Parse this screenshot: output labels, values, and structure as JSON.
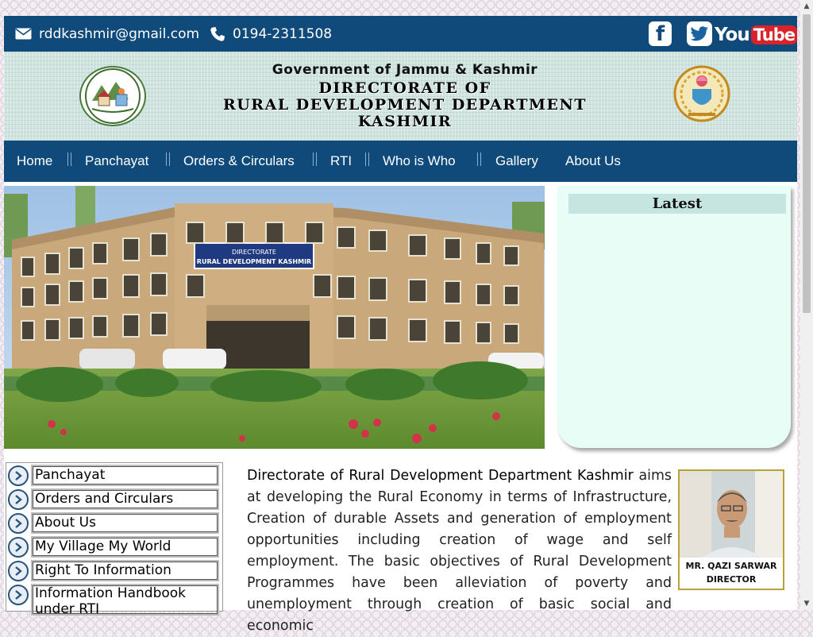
{
  "topbar": {
    "email": "rddkashmir@gmail.com",
    "phone": "0194-2311508",
    "social": {
      "facebook": "f",
      "youtube_you": "You",
      "youtube_tube": "Tube"
    }
  },
  "banner": {
    "gov_line": "Government of Jammu & Kashmir",
    "title_line1": "DIRECTORATE OF",
    "title_line2": "RURAL DEVELOPMENT DEPARTMENT",
    "title_line3": "KASHMIR",
    "left_logo_text": "MY VILLAGE, MY WORLD"
  },
  "nav": {
    "items": [
      "Home",
      "Panchayat",
      "Orders & Circulars",
      "RTI",
      "Who is Who",
      "Gallery",
      "About Us"
    ]
  },
  "hero": {
    "sign_line1": "DIRECTORATE",
    "sign_line2": "RURAL DEVELOPMENT KASHMIR"
  },
  "latest": {
    "title": "Latest"
  },
  "sidebar": {
    "items": [
      "Panchayat",
      "Orders and Circulars",
      "About Us",
      "My Village My World",
      "Right To Information",
      "Information Handbook under RTI"
    ]
  },
  "article": {
    "lead": "Directorate of Rural Development Department Kashmir",
    "body": " aims at developing the Rural Economy in terms of Infrastructure, Creation of durable Assets and generation of employment opportunities including creation of wage and self employment. The basic objectives of Rural Development Programmes have been alleviation of poverty and unemployment through creation of basic social and economic"
  },
  "director": {
    "name": "MR. QAZI SARWAR",
    "role": "DIRECTOR"
  },
  "colors": {
    "brand_blue": "#0f4a7a",
    "latest_bg": "#e8fdf5",
    "youtube_red": "#d8232a"
  }
}
